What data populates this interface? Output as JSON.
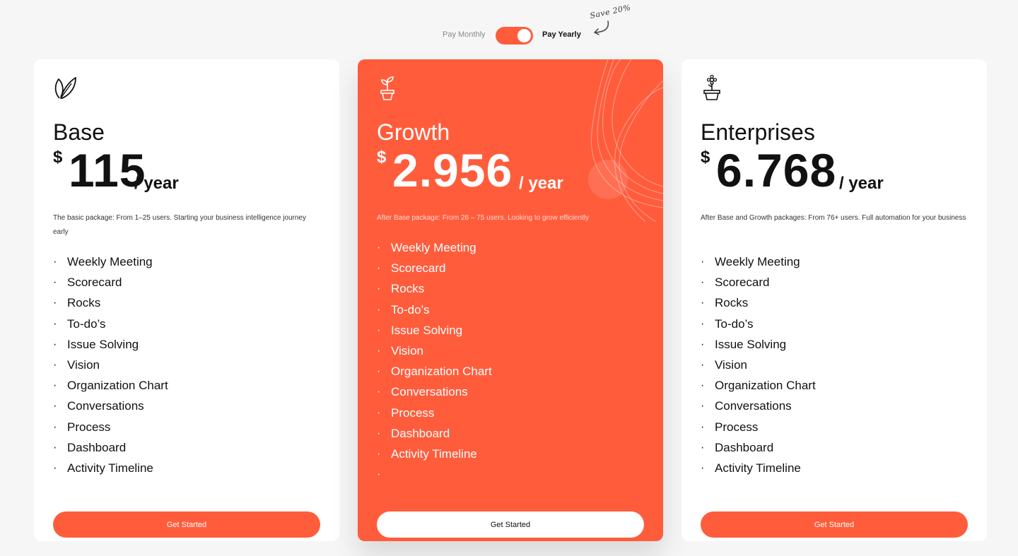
{
  "billing": {
    "monthly_label": "Pay Monthly",
    "yearly_label": "Pay Yearly",
    "yearly_selected": true,
    "save_note": "Save 20%"
  },
  "colors": {
    "accent": "#ff5c3c",
    "page_bg": "#f6f6f6",
    "card_bg": "#ffffff"
  },
  "plans": [
    {
      "icon": "leaf-icon",
      "name": "Base",
      "currency": "$",
      "amount": "115",
      "period": "/ year",
      "description": "The basic package: From 1–25 users. Starting your business intelligence journey early",
      "features": [
        "Weekly Meeting",
        "Scorecard",
        "Rocks",
        "To-do’s",
        "Issue Solving",
        "Vision",
        "Organization Chart",
        "Conversations",
        "Process",
        "Dashboard",
        "Activity Timeline"
      ],
      "cta": "Get Started"
    },
    {
      "icon": "potted-plant-icon",
      "name": "Growth",
      "currency": "$",
      "amount": "2.956",
      "period": "/ year",
      "description": "After Base package: From 26 – 75 users. Looking to grow efficiently",
      "features": [
        "Weekly Meeting",
        "Scorecard",
        "Rocks",
        "To-do’s",
        "Issue Solving",
        "Vision",
        "Organization Chart",
        "Conversations",
        "Process",
        "Dashboard",
        "Activity Timeline",
        ""
      ],
      "cta": "Get Started"
    },
    {
      "icon": "flower-pot-icon",
      "name": "Enterprises",
      "currency": "$",
      "amount": "6.768",
      "period": "/ year",
      "description": "After Base and Growth packages: From 76+ users. Full automation for your business",
      "features": [
        "Weekly Meeting",
        "Scorecard",
        "Rocks",
        "To-do’s",
        "Issue Solving",
        "Vision",
        "Organization Chart",
        "Conversations",
        "Process",
        "Dashboard",
        "Activity Timeline"
      ],
      "cta": "Get Started"
    }
  ]
}
